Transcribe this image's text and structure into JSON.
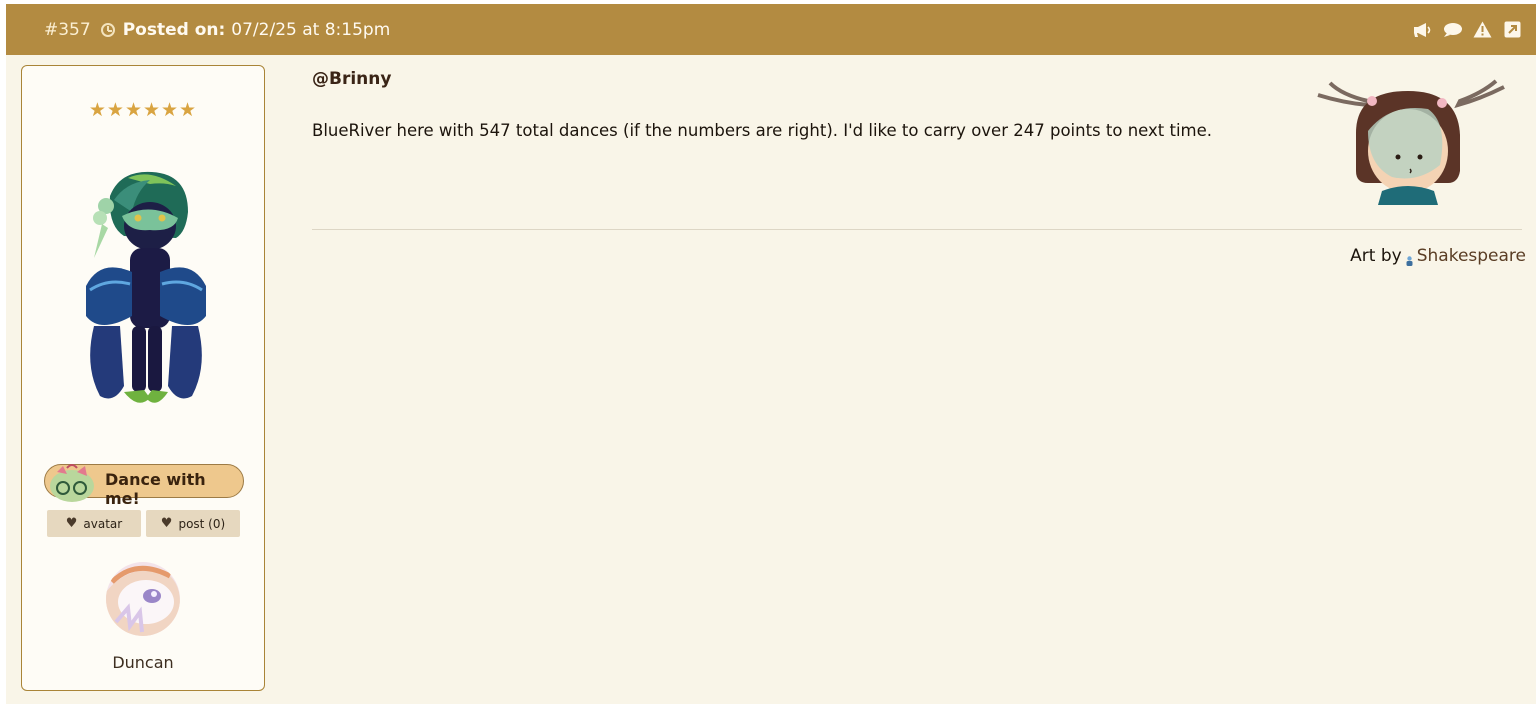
{
  "post": {
    "number": "#357",
    "posted_label": "Posted on:",
    "posted_date": "07/2/25 at 8:15pm",
    "header_icons": [
      "megaphone-icon",
      "speech-bubble-icon",
      "warning-icon",
      "external-link-icon"
    ]
  },
  "sidebar": {
    "stars": "★★★★★★",
    "dance_button": "Dance with me!",
    "like_avatar": "avatar",
    "like_post": "post (0)",
    "author_name": "Duncan"
  },
  "content": {
    "mention": "@Brinny",
    "body": "BlueRiver here with 547 total dances (if the numbers are right). I'd like to carry over 247 points to next time.",
    "art_by_label": "Art by",
    "art_by_name": "Shakespeare"
  },
  "colors": {
    "header_bg": "#b38b41",
    "page_bg": "#f9f5e8",
    "star": "#d9a441",
    "button_bg": "#eec88d",
    "like_bg": "#e6d8bf"
  }
}
